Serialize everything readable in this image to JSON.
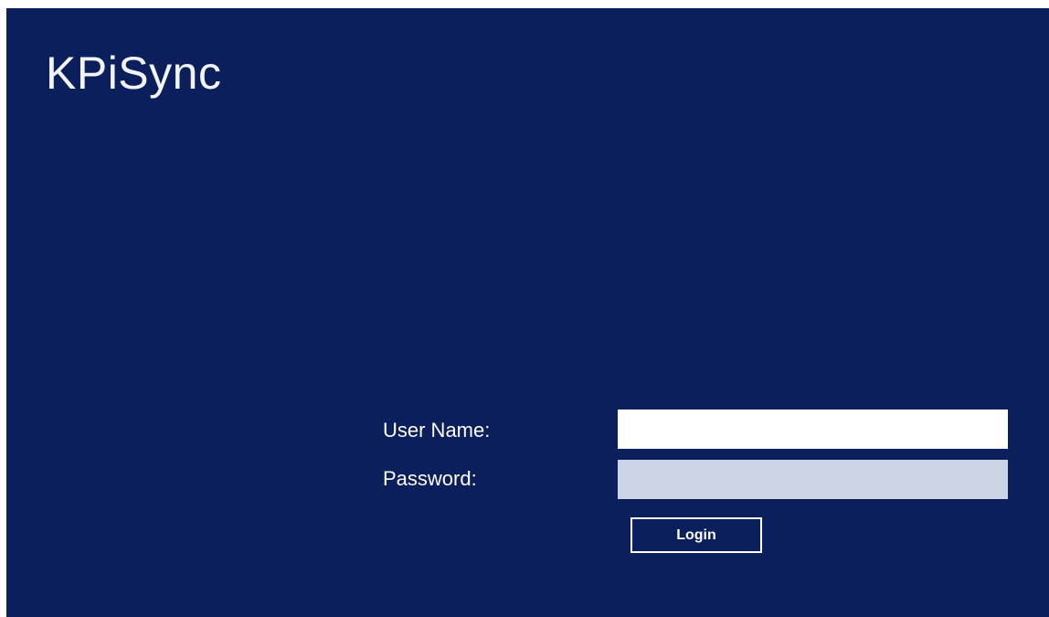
{
  "app": {
    "title": "KPiSync",
    "background_color": "#0a1f5c"
  },
  "login_form": {
    "username_label": "User Name:",
    "username_value": "",
    "password_label": "Password:",
    "password_value": "",
    "login_button_label": "Login"
  }
}
